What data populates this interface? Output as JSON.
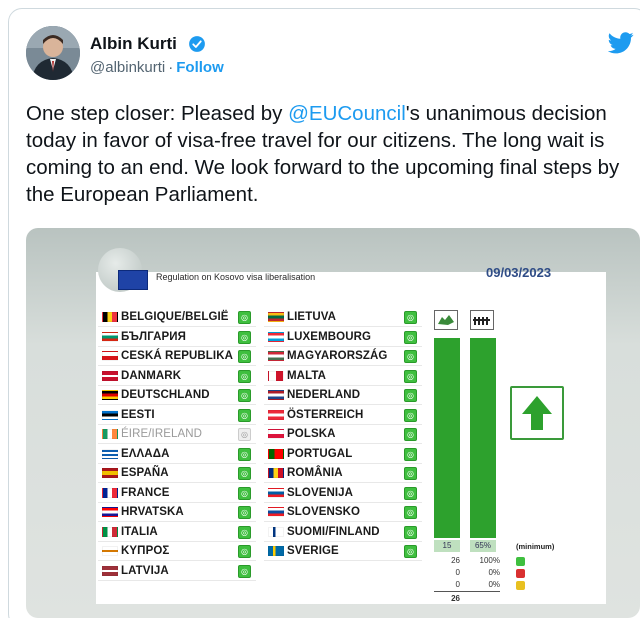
{
  "author": {
    "name": "Albin Kurti",
    "handle": "@albinkurti",
    "separator": "·",
    "follow_label": "Follow"
  },
  "tweet": {
    "text_before": "One step closer: Pleased by ",
    "mention": "@EUCouncil",
    "text_after": "'s unanimous decision today in favor of visa-free travel for our citizens. The long wait is coming to an end. We look forward to the upcoming final steps by the European Parliament."
  },
  "board": {
    "title": "Regulation on Kosovo visa liberalisation",
    "date": "09/03/2023",
    "yes_mark": "◎",
    "countries_left": [
      {
        "name": "BELGIQUE/BELGIË",
        "vote": "yes"
      },
      {
        "name": "БЪЛГАРИЯ",
        "vote": "yes"
      },
      {
        "name": "CESKÁ REPUBLIKA",
        "vote": "yes"
      },
      {
        "name": "DANMARK",
        "vote": "yes"
      },
      {
        "name": "DEUTSCHLAND",
        "vote": "yes"
      },
      {
        "name": "EESTI",
        "vote": "yes"
      },
      {
        "name": "ÉIRE/IRELAND",
        "vote": "abstain"
      },
      {
        "name": "ΕΛΛΑΔΑ",
        "vote": "yes"
      },
      {
        "name": "ESPAÑA",
        "vote": "yes"
      },
      {
        "name": "FRANCE",
        "vote": "yes"
      },
      {
        "name": "HRVATSKA",
        "vote": "yes"
      },
      {
        "name": "ITALIA",
        "vote": "yes"
      },
      {
        "name": "ΚΥΠΡΟΣ",
        "vote": "yes"
      },
      {
        "name": "LATVIJA",
        "vote": "yes"
      }
    ],
    "countries_right": [
      {
        "name": "LIETUVA",
        "vote": "yes"
      },
      {
        "name": "LUXEMBOURG",
        "vote": "yes"
      },
      {
        "name": "MAGYARORSZÁG",
        "vote": "yes"
      },
      {
        "name": "MALTA",
        "vote": "yes"
      },
      {
        "name": "NEDERLAND",
        "vote": "yes"
      },
      {
        "name": "ÖSTERREICH",
        "vote": "yes"
      },
      {
        "name": "POLSKA",
        "vote": "yes"
      },
      {
        "name": "PORTUGAL",
        "vote": "yes"
      },
      {
        "name": "ROMÂNIA",
        "vote": "yes"
      },
      {
        "name": "SLOVENIJA",
        "vote": "yes"
      },
      {
        "name": "SLOVENSKO",
        "vote": "yes"
      },
      {
        "name": "SUOMI/FINLAND",
        "vote": "yes"
      },
      {
        "name": "SVERIGE",
        "vote": "yes"
      }
    ],
    "stats": {
      "states": "15",
      "population": "65%",
      "minimum_label": "(minimum)",
      "yes_count": "26",
      "yes_pct": "100%",
      "no_count": "0",
      "no_pct": "0%",
      "abs_count": "0",
      "abs_pct": "0%",
      "total": "26"
    }
  },
  "colors": {
    "accent": "#1d9bf0",
    "vote_yes": "#2da12d",
    "date": "#2f4c86"
  }
}
